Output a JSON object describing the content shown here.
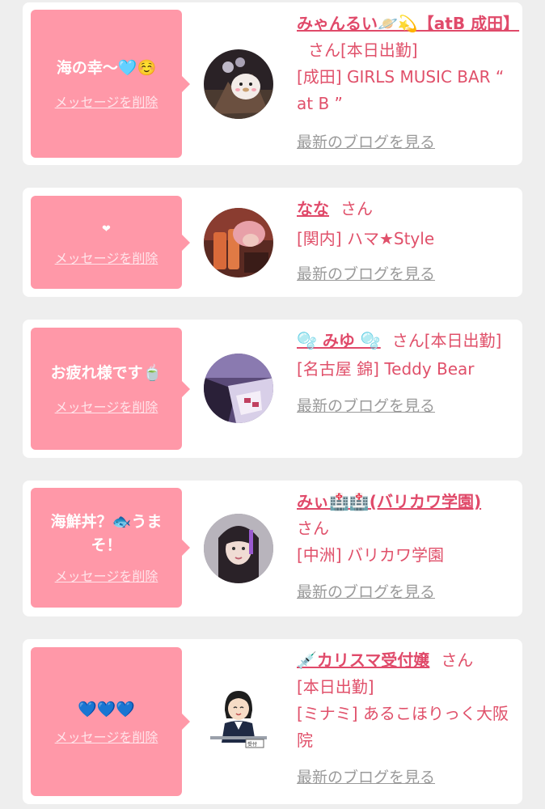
{
  "common": {
    "delete_label": "メッセージを削除",
    "blog_label": "最新のブログを見る",
    "san": "さん"
  },
  "cards": [
    {
      "message": "海の幸〜🩵☺️",
      "name": "みゃんるい🪐💫【atB 成田】",
      "status": "[本日出勤]",
      "shop": "[成田] GIRLS MUSIC BAR “ at B ”"
    },
    {
      "message": "❤",
      "name": "なな",
      "status": "",
      "shop": "[関内] ハマ★Style"
    },
    {
      "message": "お疲れ様です🍵",
      "name": "🫧 みゆ 🫧",
      "status": "[本日出勤]",
      "shop": "[名古屋 錦] Teddy Bear"
    },
    {
      "message": "海鮮丼？🐟うまそ！",
      "name": "みぃ🏥🏥(バリカワ学園)",
      "status": "",
      "shop": "[中洲] バリカワ学園"
    },
    {
      "message": "💙💙💙",
      "name": "💉カリスマ受付嬢",
      "status": "[本日出勤]",
      "shop": "[ミナミ] あるこほりっく大阪院"
    }
  ]
}
